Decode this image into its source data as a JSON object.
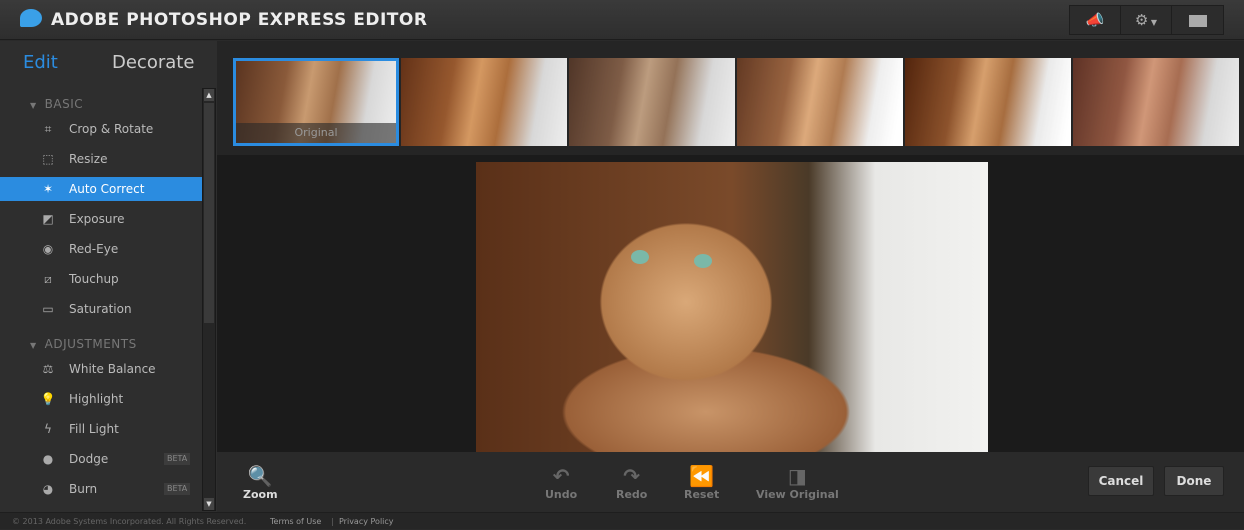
{
  "header": {
    "title": "ADOBE PHOTOSHOP EXPRESS EDITOR"
  },
  "sidebar": {
    "tabs": [
      {
        "label": "Edit"
      },
      {
        "label": "Decorate"
      }
    ],
    "sections": [
      {
        "label": "BASIC",
        "items": [
          {
            "label": "Crop & Rotate"
          },
          {
            "label": "Resize"
          },
          {
            "label": "Auto Correct"
          },
          {
            "label": "Exposure"
          },
          {
            "label": "Red-Eye"
          },
          {
            "label": "Touchup"
          },
          {
            "label": "Saturation"
          }
        ]
      },
      {
        "label": "ADJUSTMENTS",
        "items": [
          {
            "label": "White Balance"
          },
          {
            "label": "Highlight"
          },
          {
            "label": "Fill Light"
          },
          {
            "label": "Dodge",
            "badge": "BETA"
          },
          {
            "label": "Burn",
            "badge": "BETA"
          }
        ]
      }
    ]
  },
  "thumbnails": {
    "selected_caption": "Original"
  },
  "toolbar": {
    "zoom": "Zoom",
    "undo": "Undo",
    "redo": "Redo",
    "reset": "Reset",
    "view_original": "View Original",
    "cancel": "Cancel",
    "done": "Done"
  },
  "footer": {
    "copyright": "© 2013 Adobe Systems Incorporated. All Rights Reserved.",
    "terms": "Terms of Use",
    "separator": "|",
    "privacy": "Privacy Policy"
  },
  "colors": {
    "accent": "#2b8ce0"
  }
}
